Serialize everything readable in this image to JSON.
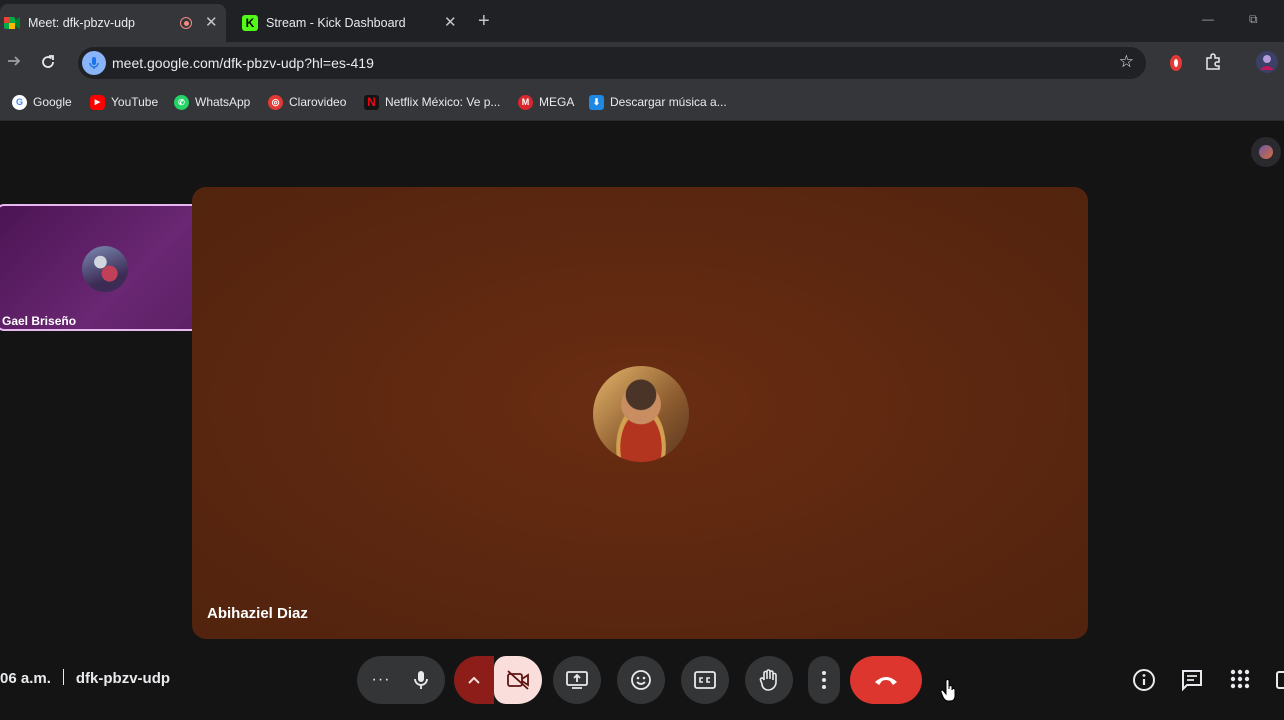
{
  "browser": {
    "tabs": [
      {
        "title": "Meet: dfk-pbzv-udp",
        "active": true,
        "recording": true
      },
      {
        "title": "Stream - Kick Dashboard",
        "active": false
      }
    ],
    "url": "meet.google.com/dfk-pbzv-udp?hl=es-419",
    "window_buttons": {
      "minimize": "—",
      "restore": "⧉"
    },
    "bookmarks": [
      {
        "label": "Google",
        "icon": "google-icon"
      },
      {
        "label": "YouTube",
        "icon": "youtube-icon"
      },
      {
        "label": "WhatsApp",
        "icon": "whatsapp-icon"
      },
      {
        "label": "Clarovideo",
        "icon": "clarovideo-icon"
      },
      {
        "label": "Netflix México: Ve p...",
        "icon": "netflix-icon"
      },
      {
        "label": "MEGA",
        "icon": "mega-icon"
      },
      {
        "label": "Descargar música a...",
        "icon": "download-icon"
      }
    ]
  },
  "meet": {
    "main_participant": {
      "name": "Abihaziel Diaz"
    },
    "side_participant": {
      "name": "Gael Briseño"
    },
    "time": "06 a.m.",
    "meeting_code": "dfk-pbzv-udp"
  },
  "colors": {
    "tile_bg": "#5e2810",
    "side_tile_border": "#e7b7f0",
    "end_call": "#dc362e",
    "camera_off_bg": "#f9dedc",
    "camera_caret_bg": "#8c1d18"
  }
}
